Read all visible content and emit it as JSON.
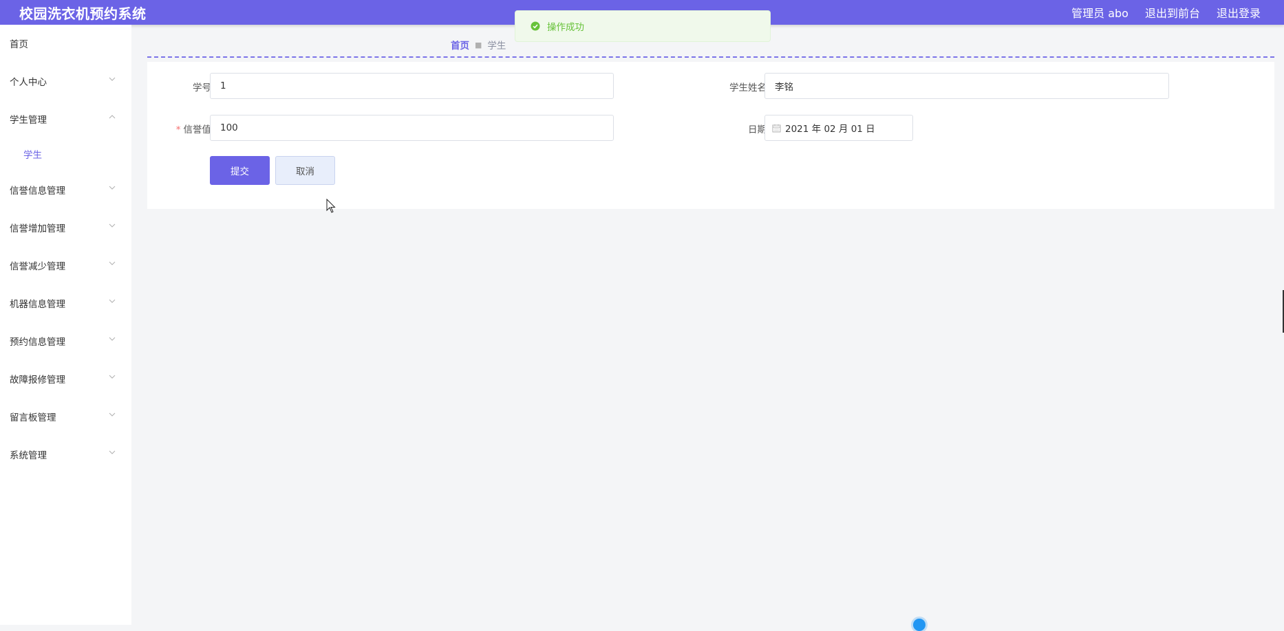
{
  "header": {
    "app_title": "校园洗衣机预约系统",
    "admin_label": "管理员 abo",
    "to_frontend": "退出到前台",
    "logout": "退出登录"
  },
  "sidebar": {
    "items": [
      {
        "label": "首页",
        "expandable": false
      },
      {
        "label": "个人中心",
        "expandable": true,
        "expanded": false
      },
      {
        "label": "学生管理",
        "expandable": true,
        "expanded": true
      },
      {
        "label": "学生",
        "sub": true,
        "active": true
      },
      {
        "label": "信誉信息管理",
        "expandable": true,
        "expanded": false
      },
      {
        "label": "信誉增加管理",
        "expandable": true,
        "expanded": false
      },
      {
        "label": "信誉减少管理",
        "expandable": true,
        "expanded": false
      },
      {
        "label": "机器信息管理",
        "expandable": true,
        "expanded": false
      },
      {
        "label": "预约信息管理",
        "expandable": true,
        "expanded": false
      },
      {
        "label": "故障报修管理",
        "expandable": true,
        "expanded": false
      },
      {
        "label": "留言板管理",
        "expandable": true,
        "expanded": false
      },
      {
        "label": "系统管理",
        "expandable": true,
        "expanded": false
      }
    ]
  },
  "breadcrumb": {
    "home": "首页",
    "separator": "■",
    "current": "学生"
  },
  "form": {
    "student_id": {
      "label": "学号",
      "value": "1"
    },
    "student_name": {
      "label": "学生姓名",
      "value": "李铭"
    },
    "credit": {
      "label": "信誉值",
      "required_mark": "*",
      "value": "100"
    },
    "date": {
      "label": "日期",
      "value": "2021 年 02 月 01 日"
    },
    "submit_label": "提交",
    "cancel_label": "取消"
  },
  "toast": {
    "message": "操作成功",
    "type": "success"
  },
  "colors": {
    "primary": "#6b63e6",
    "success": "#67c23a",
    "page_bg": "#f4f5f7"
  },
  "icons": {
    "chevron": "chevron-icon",
    "calendar": "calendar-icon",
    "success": "check-circle-icon"
  }
}
